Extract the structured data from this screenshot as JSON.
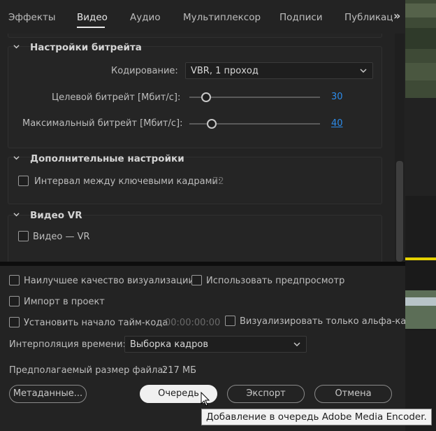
{
  "tabs": [
    {
      "label": "Эффекты"
    },
    {
      "label": "Видео"
    },
    {
      "label": "Аудио"
    },
    {
      "label": "Мультиплексор"
    },
    {
      "label": "Подписи"
    },
    {
      "label": "Публикац"
    }
  ],
  "more_label": "»",
  "bitrate": {
    "title": "Настройки битрейта",
    "encoding_label": "Кодирование:",
    "encoding_value": "VBR, 1 проход",
    "target_label": "Целевой битрейт [Мбит/с]:",
    "target_value": "30",
    "target_level": 0.13,
    "max_label": "Максимальный битрейт [Мбит/с]:",
    "max_value": "40",
    "max_level": 0.17
  },
  "advanced": {
    "title": "Дополнительные настройки",
    "keyframe_label": "Интервал между ключевыми кадрами:",
    "keyframe_value": "72"
  },
  "vr": {
    "title": "Видео VR",
    "vr_label": "Видео — VR"
  },
  "options": {
    "max_quality": "Наилучшее качество визуализации",
    "use_preview": "Использовать предпросмотр",
    "import_project": "Импорт в проект",
    "set_timecode": "Установить начало тайм-кода",
    "timecode_value": "00:00:00:00",
    "alpha_only": "Визуализировать только альфа-канал"
  },
  "interpolation": {
    "label": "Интерполяция времени:",
    "value": "Выборка кадров"
  },
  "filesize": {
    "label": "Предполагаемый размер файла:",
    "value": "217 МБ"
  },
  "buttons": {
    "metadata": "Метаданные...",
    "queue": "Очередь",
    "export": "Экспорт",
    "cancel": "Отмена"
  },
  "tooltip": "Добавление в очередь Adobe Media Encoder.",
  "colors": {
    "accent": "#2d8ceb",
    "primary_button": "#f0f0f0",
    "timeline_marker": "#e6d200"
  }
}
